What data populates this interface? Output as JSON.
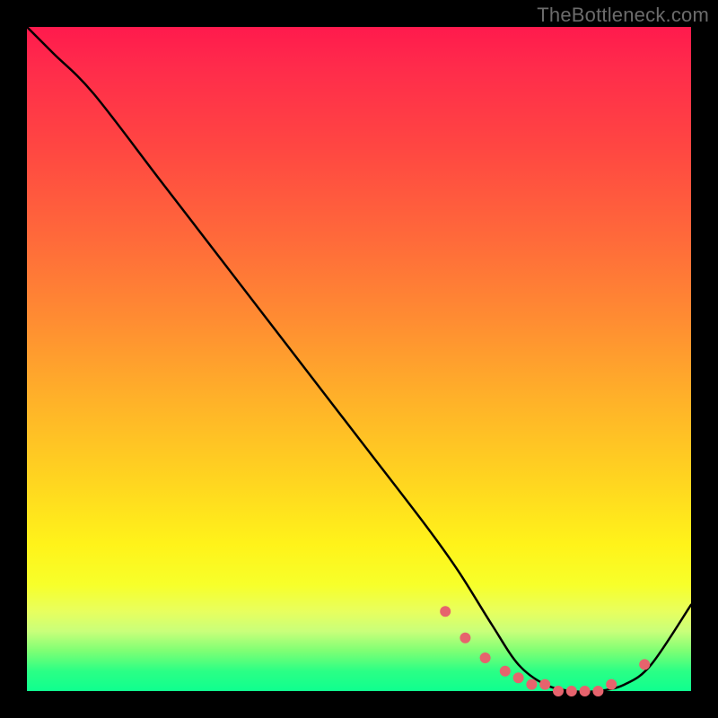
{
  "watermark": "TheBottleneck.com",
  "chart_data": {
    "type": "line",
    "title": "",
    "xlabel": "",
    "ylabel": "",
    "xlim": [
      0,
      100
    ],
    "ylim": [
      0,
      100
    ],
    "series": [
      {
        "name": "curve",
        "x": [
          0,
          4,
          10,
          20,
          30,
          40,
          50,
          60,
          65,
          70,
          74,
          78,
          82,
          86,
          90,
          94,
          100
        ],
        "y": [
          100,
          96,
          90,
          77,
          64,
          51,
          38,
          25,
          18,
          10,
          4,
          1,
          0,
          0,
          1,
          4,
          13
        ]
      }
    ],
    "markers": {
      "x": [
        63,
        66,
        69,
        72,
        74,
        76,
        78,
        80,
        82,
        84,
        86,
        88,
        93
      ],
      "y": [
        12,
        8,
        5,
        3,
        2,
        1,
        1,
        0,
        0,
        0,
        0,
        1,
        4
      ],
      "color": "#e6636d",
      "radius_px": 6
    },
    "gradient_stops": [
      {
        "pos": 0.0,
        "color": "#ff1a4d"
      },
      {
        "pos": 0.44,
        "color": "#ff8c32"
      },
      {
        "pos": 0.78,
        "color": "#fff31a"
      },
      {
        "pos": 0.97,
        "color": "#2bff85"
      },
      {
        "pos": 1.0,
        "color": "#0fff8f"
      }
    ]
  }
}
